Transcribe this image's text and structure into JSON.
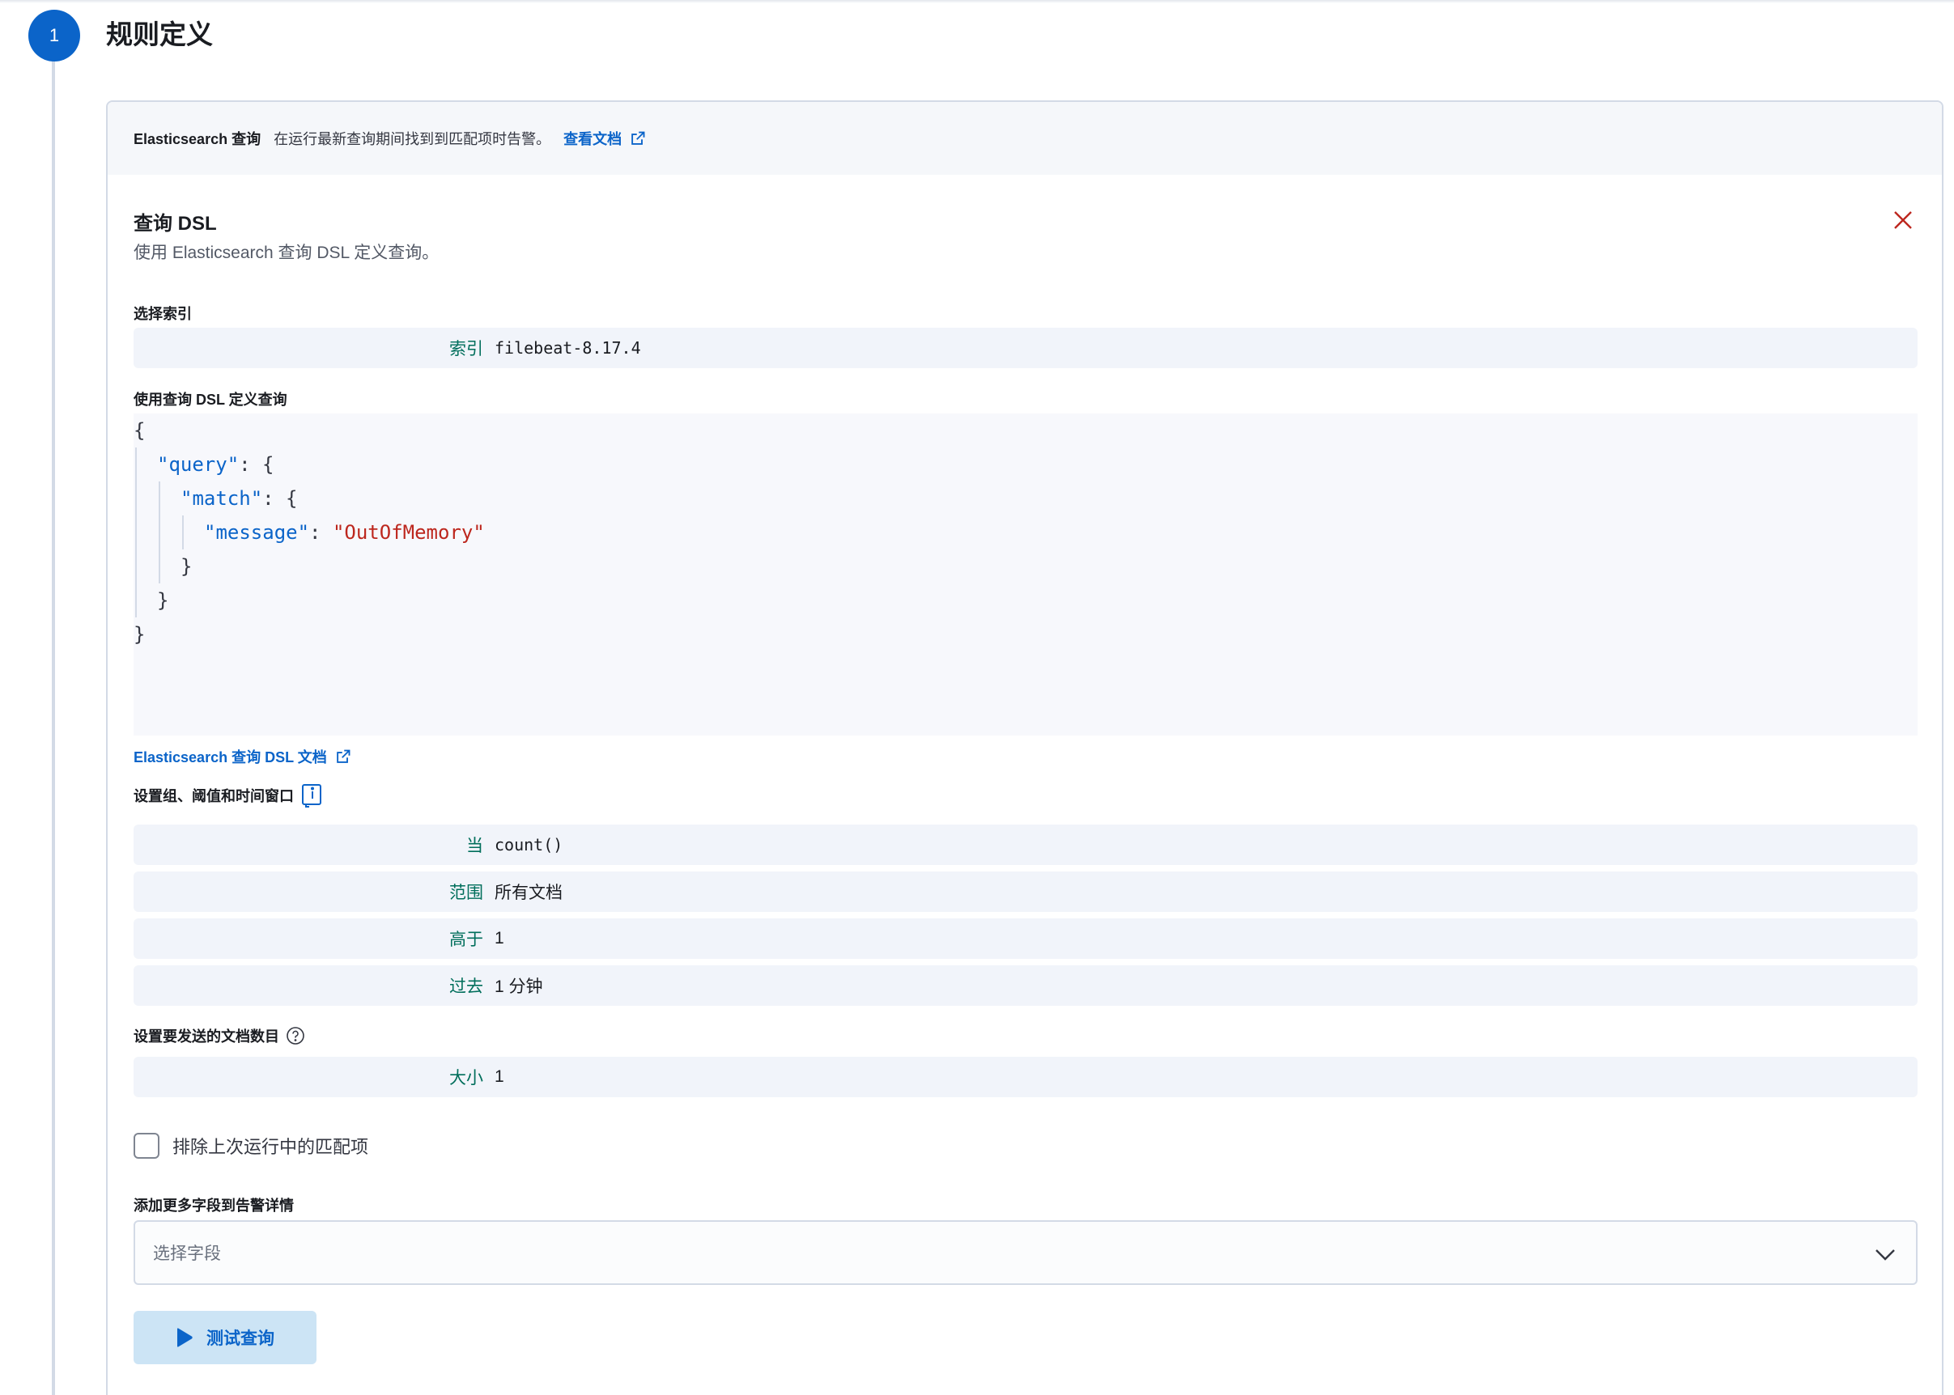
{
  "step": {
    "number": "1",
    "title": "规则定义"
  },
  "rule_type": {
    "title": "Elasticsearch 查询",
    "description": "在运行最新查询期间找到到匹配项时告警。",
    "docs_link": "查看文档"
  },
  "query_dsl": {
    "title": "查询 DSL",
    "subtitle": "使用 Elasticsearch 查询 DSL 定义查询。"
  },
  "index": {
    "label": "选择索引",
    "key": "索引",
    "value": "filebeat-8.17.4"
  },
  "dsl_editor": {
    "label": "使用查询 DSL 定义查询",
    "lines": {
      "l1": "{",
      "l2_key": "\"query\"",
      "l2_rest": ": {",
      "l3_key": "\"match\"",
      "l3_rest": ": {",
      "l4_key": "\"message\"",
      "l4_sep": ": ",
      "l4_val": "\"OutOfMemory\"",
      "l5": "}",
      "l6": "}",
      "l7": "}"
    },
    "docs_link": "Elasticsearch 查询 DSL 文档"
  },
  "threshold": {
    "label": "设置组、阈值和时间窗口",
    "rows": [
      {
        "key": "当",
        "value": "count()"
      },
      {
        "key": "范围",
        "value": "所有文档"
      },
      {
        "key": "高于",
        "value": "1"
      },
      {
        "key": "过去",
        "value": "1 分钟"
      }
    ]
  },
  "size": {
    "label": "设置要发送的文档数目",
    "key": "大小",
    "value": "1"
  },
  "exclude_matches": {
    "label": "排除上次运行中的匹配项",
    "checked": false
  },
  "more_fields": {
    "label": "添加更多字段到告警详情",
    "placeholder": "选择字段"
  },
  "test_button": {
    "label": "测试查询"
  },
  "colors": {
    "primary": "#0b64c9",
    "key_text": "#006e5b",
    "danger": "#bd271e",
    "row_bg": "#f1f4fa"
  }
}
